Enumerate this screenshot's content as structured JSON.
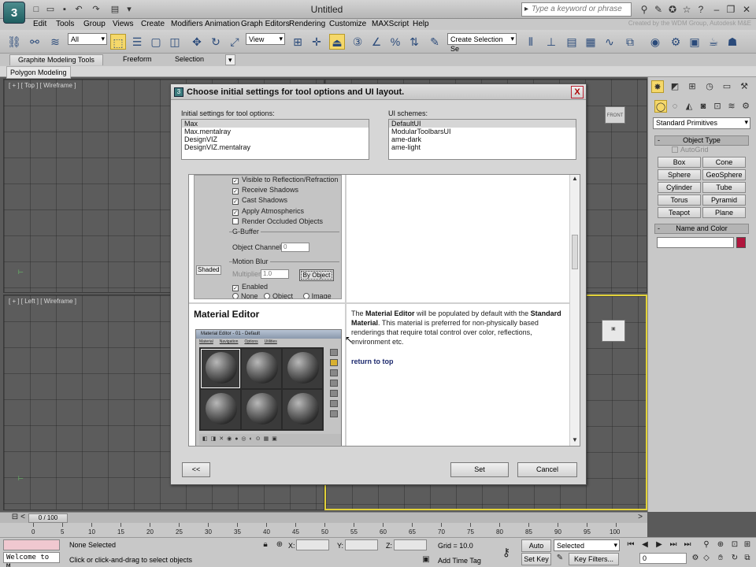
{
  "app": {
    "icon_glyph": "3",
    "title": "Untitled",
    "search_placeholder": "Type a keyword or phrase",
    "watermark": "Created by the WDM Group, Autodesk M&E"
  },
  "menu": [
    "Edit",
    "Tools",
    "Group",
    "Views",
    "Create",
    "Modifiers",
    "Animation",
    "Graph Editors",
    "Rendering",
    "Customize",
    "MAXScript",
    "Help"
  ],
  "toolbar": {
    "filter": "All",
    "ref_coord": "View",
    "named_selection": "Create Selection Se"
  },
  "ribbon": {
    "tabs": [
      "Graphite Modeling Tools",
      "Freeform",
      "Selection"
    ],
    "panel": "Polygon Modeling"
  },
  "viewports": {
    "top_label": "[ + ] [ Top ] [ Wireframe ]",
    "left_label": "[ + ] [ Left ] [ Wireframe ]",
    "front_cube": "FRONT"
  },
  "dialog": {
    "title": "Choose initial settings for tool options and UI layout.",
    "close_glyph": "X",
    "tool_options_label": "Initial settings for tool options:",
    "tool_options": [
      "Max",
      "Max.mentalray",
      "DesignVIZ",
      "DesignVIZ.mentalray"
    ],
    "ui_schemes_label": "UI schemes:",
    "ui_schemes": [
      "DefaultUI",
      "ModularToolbarsUI",
      "ame-dark",
      "ame-light"
    ],
    "props_shot": {
      "visible_reflection": "Visible to Reflection/Refraction",
      "receive_shadows": "Receive Shadows",
      "cast_shadows": "Cast Shadows",
      "apply_atmospherics": "Apply Atmospherics",
      "render_occluded": "Render Occluded Objects",
      "gbuffer_group": "G-Buffer",
      "object_channel_label": "Object Channel:",
      "object_channel_value": "0",
      "motion_blur_group": "Motion Blur",
      "multiplier_label": "Multiplier:",
      "multiplier_value": "1.0",
      "by_object": "By Object",
      "enabled": "Enabled",
      "none": "None",
      "object": "Object",
      "image": "Image",
      "shaded": "Shaded"
    },
    "material_editor": {
      "heading": "Material Editor",
      "shot_title": "Material Editor - 01 - Default",
      "shot_menu": [
        "Material",
        "Navigation",
        "Options",
        "Utilities"
      ],
      "desc_1": "The ",
      "desc_2": "Material Editor",
      "desc_3": " will be populated by default with the ",
      "desc_4": "Standard Material",
      "desc_5": ". This material is preferred for non-physically based renderings that require total control over color, reflections, environment etc.",
      "return_link": "return to top"
    },
    "back_button": "<<",
    "set_button": "Set",
    "cancel_button": "Cancel"
  },
  "command_panel": {
    "category": "Standard Primitives",
    "object_type_rollout": "Object Type",
    "autogrid": "AutoGrid",
    "primitives": [
      "Box",
      "Cone",
      "Sphere",
      "GeoSphere",
      "Cylinder",
      "Tube",
      "Torus",
      "Pyramid",
      "Teapot",
      "Plane"
    ],
    "name_color_rollout": "Name and Color",
    "color": "#b0163d"
  },
  "timeline": {
    "frame": "0 / 100",
    "ticks": [
      "0",
      "5",
      "10",
      "15",
      "20",
      "25",
      "30",
      "35",
      "40",
      "45",
      "50",
      "55",
      "60",
      "65",
      "70",
      "75",
      "80",
      "85",
      "90",
      "95",
      "100"
    ]
  },
  "status": {
    "listener": "Welcome to M",
    "selection": "None Selected",
    "prompt": "Click or click-and-drag to select objects",
    "x_label": "X:",
    "y_label": "Y:",
    "z_label": "Z:",
    "grid": "Grid = 10.0",
    "add_time_tag": "Add Time Tag",
    "auto_key": "Auto Key",
    "set_key": "Set Key",
    "selected": "Selected",
    "key_filters": "Key Filters...",
    "frame_field": "0"
  }
}
